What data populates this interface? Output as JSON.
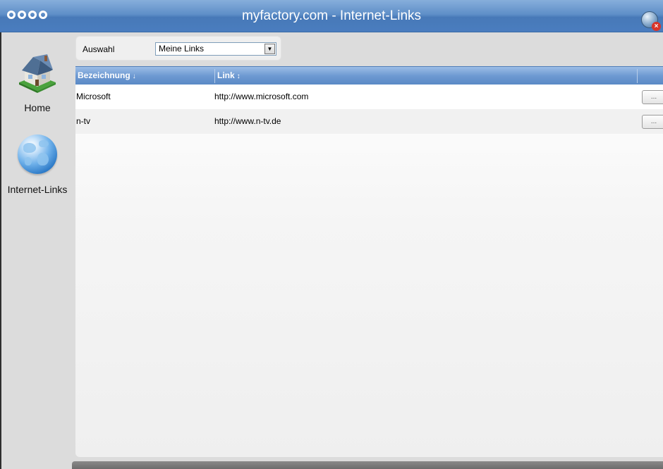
{
  "window": {
    "title": "myfactory.com - Internet-Links",
    "close_icon": "globe-close-icon"
  },
  "sidebar": {
    "items": [
      {
        "label": "Home",
        "icon": "house-icon"
      },
      {
        "label": "Internet-Links",
        "icon": "globe-icon"
      }
    ]
  },
  "filter": {
    "label": "Auswahl",
    "selected": "Meine Links",
    "dropdown_icon": "chevron-down-icon"
  },
  "grid": {
    "columns": [
      {
        "label": "Bezeichnung",
        "sort_indicator": "↓"
      },
      {
        "label": "Link",
        "sort_indicator": "↕"
      }
    ],
    "rows": [
      {
        "name": "Microsoft",
        "link": "http://www.microsoft.com",
        "action": "..."
      },
      {
        "name": "n-tv",
        "link": "http://www.n-tv.de",
        "action": "..."
      }
    ]
  },
  "colors": {
    "titlebar": "#5f8fc8",
    "header": "#6e9ad2",
    "background": "#dcdcdc"
  }
}
